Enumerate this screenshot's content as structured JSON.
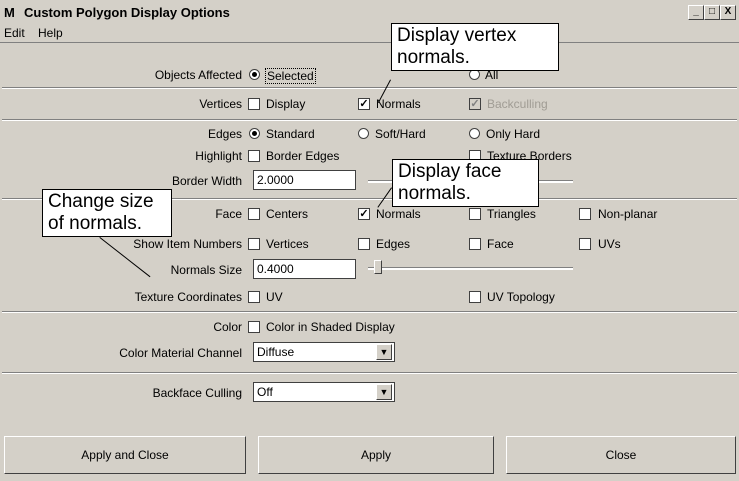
{
  "window": {
    "title": "Custom Polygon Display Options",
    "logo_glyph": "M",
    "minimize": "_",
    "maximize": "□",
    "close": "X"
  },
  "menu": {
    "edit": "Edit",
    "help": "Help"
  },
  "objects_affected": {
    "label": "Objects Affected",
    "selected": "Selected",
    "all": "All",
    "selected_on": true
  },
  "vertices": {
    "label": "Vertices",
    "display": "Display",
    "normals": "Normals",
    "backculling": "Backculling"
  },
  "edges": {
    "label": "Edges",
    "standard": "Standard",
    "soft_hard": "Soft/Hard",
    "only_hard": "Only Hard"
  },
  "highlight": {
    "label": "Highlight",
    "border_edges": "Border Edges",
    "texture_borders": "Texture Borders"
  },
  "border_width": {
    "label": "Border Width",
    "value": "2.0000"
  },
  "face": {
    "label": "Face",
    "centers": "Centers",
    "normals": "Normals",
    "triangles": "Triangles",
    "non_planar": "Non-planar"
  },
  "show_item_numbers": {
    "label": "Show Item Numbers",
    "vertices": "Vertices",
    "edges": "Edges",
    "face": "Face",
    "uvs": "UVs"
  },
  "normals_size": {
    "label": "Normals Size",
    "value": "0.4000"
  },
  "texture_coordinates": {
    "label": "Texture Coordinates",
    "uv": "UV",
    "uv_topology": "UV Topology"
  },
  "color": {
    "label": "Color",
    "shaded": "Color in Shaded Display"
  },
  "color_material_channel": {
    "label": "Color Material Channel",
    "value": "Diffuse"
  },
  "backface_culling": {
    "label": "Backface Culling",
    "value": "Off"
  },
  "buttons": {
    "apply_close": "Apply and Close",
    "apply": "Apply",
    "close": "Close"
  },
  "callouts": {
    "vertex_normals": "Display vertex normals.",
    "face_normals": "Display face normals.",
    "normals_size": "Change size of normals."
  }
}
